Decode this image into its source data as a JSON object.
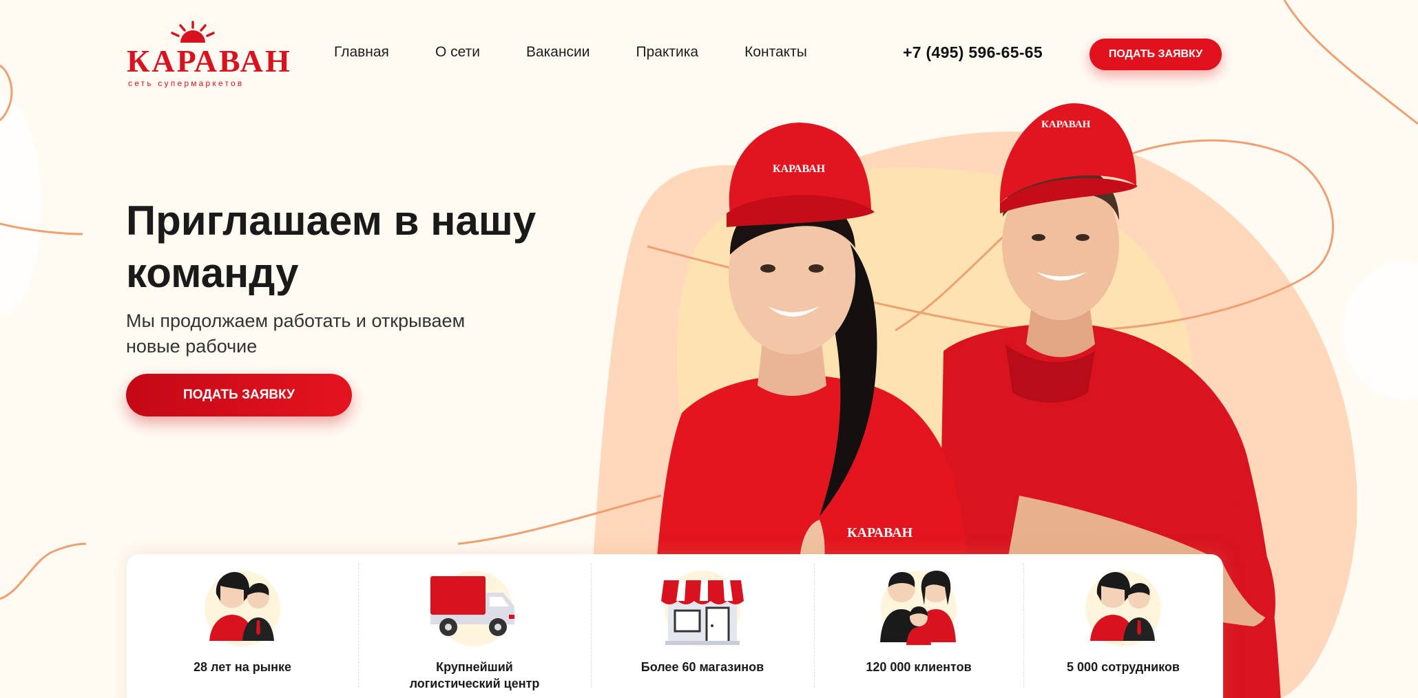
{
  "brand": {
    "name": "КАРАВАН",
    "tagline": "сеть супермаркетов",
    "accent": "#e0101c"
  },
  "nav": {
    "items": [
      {
        "label": "Главная"
      },
      {
        "label": "О сети"
      },
      {
        "label": "Вакансии"
      },
      {
        "label": "Практика"
      },
      {
        "label": "Контакты"
      }
    ]
  },
  "header": {
    "phone": "+7 (495) 596-65-65",
    "cta_label": "ПОДАТЬ ЗАЯВКУ"
  },
  "hero": {
    "title": "Приглашаем в нашу команду",
    "subtitle": "Мы продолжаем работать и открываем новые рабочие",
    "cta_label": "ПОДАТЬ ЗАЯВКУ",
    "cap_logo_text": "КАРАВАН"
  },
  "stats": [
    {
      "icon": "people-pair-icon",
      "label": "28 лет на рынке"
    },
    {
      "icon": "truck-icon",
      "label": "Крупнейший логистический центр"
    },
    {
      "icon": "store-icon",
      "label": "Более 60 магазинов"
    },
    {
      "icon": "family-icon",
      "label": "120 000 клиентов"
    },
    {
      "icon": "employees-icon",
      "label": "5 000 сотрудников"
    }
  ]
}
